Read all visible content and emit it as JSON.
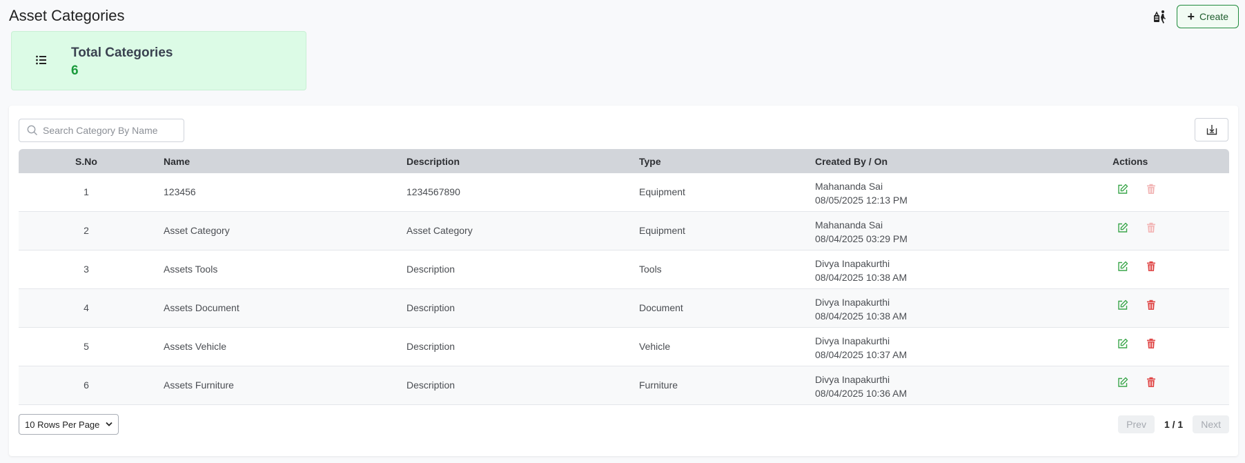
{
  "page": {
    "title": "Asset Categories"
  },
  "toolbar": {
    "create_label": "Create",
    "filter_icon": "reset-filter-icon"
  },
  "stat": {
    "label": "Total Categories",
    "value": "6",
    "icon": "list-icon"
  },
  "search": {
    "placeholder": "Search Category By Name",
    "value": ""
  },
  "table": {
    "headers": {
      "sno": "S.No",
      "name": "Name",
      "description": "Description",
      "type": "Type",
      "created": "Created By / On",
      "actions": "Actions"
    },
    "rows": [
      {
        "sno": "1",
        "name": "123456",
        "description": "1234567890",
        "type": "Equipment",
        "created_by": "Mahananda Sai",
        "created_on": "08/05/2025 12:13 PM",
        "delete_enabled": false
      },
      {
        "sno": "2",
        "name": "Asset Category",
        "description": "Asset Category",
        "type": "Equipment",
        "created_by": "Mahananda Sai",
        "created_on": "08/04/2025 03:29 PM",
        "delete_enabled": false
      },
      {
        "sno": "3",
        "name": "Assets Tools",
        "description": "Description",
        "type": "Tools",
        "created_by": "Divya Inapakurthi",
        "created_on": "08/04/2025 10:38 AM",
        "delete_enabled": true
      },
      {
        "sno": "4",
        "name": "Assets Document",
        "description": "Description",
        "type": "Document",
        "created_by": "Divya Inapakurthi",
        "created_on": "08/04/2025 10:38 AM",
        "delete_enabled": true
      },
      {
        "sno": "5",
        "name": "Assets Vehicle",
        "description": "Description",
        "type": "Vehicle",
        "created_by": "Divya Inapakurthi",
        "created_on": "08/04/2025 10:37 AM",
        "delete_enabled": true
      },
      {
        "sno": "6",
        "name": "Assets Furniture",
        "description": "Description",
        "type": "Furniture",
        "created_by": "Divya Inapakurthi",
        "created_on": "08/04/2025 10:36 AM",
        "delete_enabled": true
      }
    ]
  },
  "pagination": {
    "rows_per_page": "10 Rows Per Page",
    "prev_label": "Prev",
    "next_label": "Next",
    "page_info": "1 / 1"
  },
  "colors": {
    "accent_green": "#1a9a3c",
    "edit_green": "#3aa64a",
    "delete_red": "#e04b4b",
    "delete_disabled": "#f2b6b6"
  }
}
